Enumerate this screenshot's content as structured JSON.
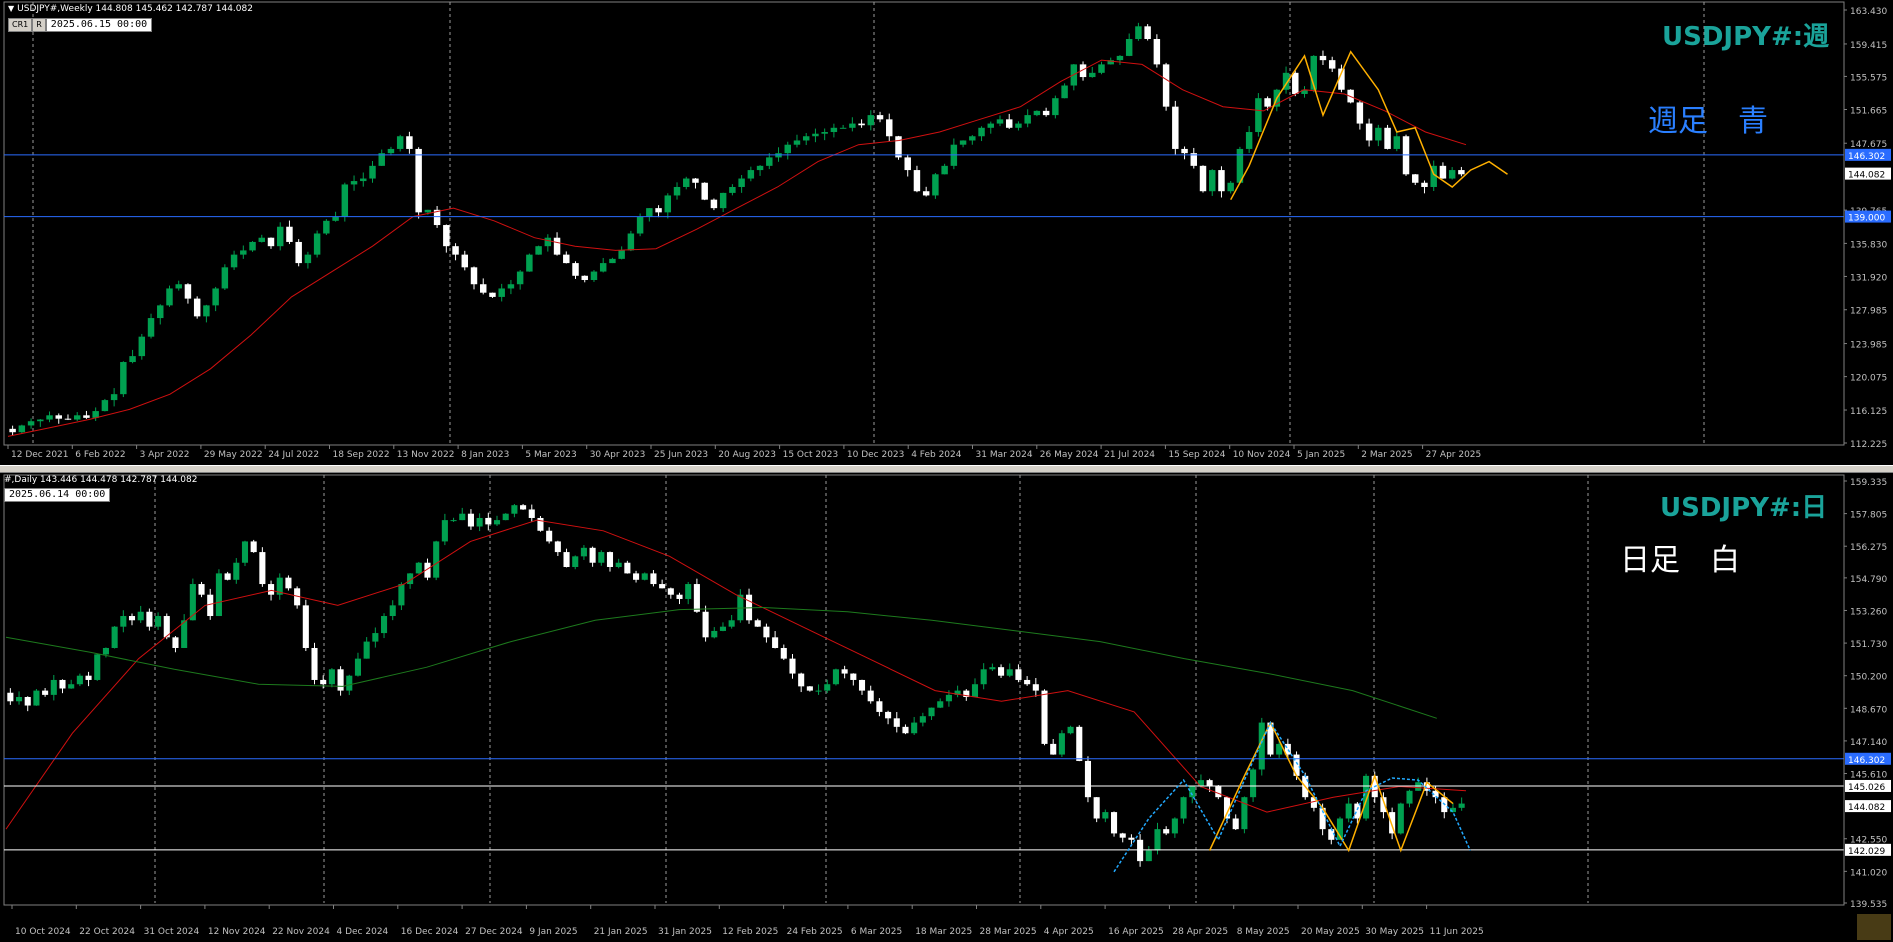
{
  "colors": {
    "up": "#00a050",
    "down": "#ffffff",
    "ma_red": "#d01010",
    "ma_green": "#1d7a1d",
    "hline_blue": "#2a6cff",
    "hline_white": "#ffffff",
    "wave_yellow": "#ffb000",
    "wave_cyan": "#22aaff",
    "symbol": "#1aa39a",
    "label_blue": "#2a7fff",
    "label_white": "#ffffff",
    "priceTag": "#2a6cff"
  },
  "top": {
    "header": "USDJPY#,Weekly  144.808 145.462 142.787 144.082",
    "btn1": "CR1",
    "btn2": "R",
    "date": "2025.06.15 00:00",
    "symbol": "USDJPY#:週",
    "caption": "週足　青",
    "yticks": [
      "163.430",
      "159.415",
      "155.575",
      "151.665",
      "147.675",
      "146.302",
      "144.082",
      "139.765",
      "139.000",
      "135.830",
      "131.920",
      "127.985",
      "123.985",
      "120.075",
      "116.125",
      "112.225"
    ],
    "xticks": [
      "12 Dec 2021",
      "6 Feb 2022",
      "3 Apr 2022",
      "29 May 2022",
      "24 Jul 2022",
      "18 Sep 2022",
      "13 Nov 2022",
      "8 Jan 2023",
      "5 Mar 2023",
      "30 Apr 2023",
      "25 Jun 2023",
      "20 Aug 2023",
      "15 Oct 2023",
      "10 Dec 2023",
      "4 Feb 2024",
      "31 Mar 2024",
      "26 May 2024",
      "21 Jul 2024",
      "15 Sep 2024",
      "10 Nov 2024",
      "5 Jan 2025",
      "2 Mar 2025",
      "27 Apr 2025"
    ]
  },
  "bottom": {
    "header": "#,Daily  143.446 144.478 142.787 144.082",
    "date": "2025.06.14 00:00",
    "symbol": "USDJPY#:日",
    "caption": "日足　白",
    "yticks": [
      "159.335",
      "157.805",
      "156.275",
      "154.790",
      "153.260",
      "151.730",
      "150.200",
      "148.670",
      "147.140",
      "146.302",
      "145.610",
      "145.026",
      "144.082",
      "142.550",
      "142.029",
      "141.020",
      "139.535"
    ],
    "xticks": [
      "10 Oct 2024",
      "22 Oct 2024",
      "31 Oct 2024",
      "12 Nov 2024",
      "22 Nov 2024",
      "4 Dec 2024",
      "16 Dec 2024",
      "27 Dec 2024",
      "9 Jan 2025",
      "21 Jan 2025",
      "31 Jan 2025",
      "12 Feb 2025",
      "24 Feb 2025",
      "6 Mar 2025",
      "18 Mar 2025",
      "28 Mar 2025",
      "4 Apr 2025",
      "16 Apr 2025",
      "28 Apr 2025",
      "8 May 2025",
      "20 May 2025",
      "30 May 2025",
      "11 Jun 2025"
    ]
  },
  "chart_data": [
    {
      "type": "candlestick",
      "title": "USDJPY#,Weekly",
      "ylim": [
        112.225,
        163.43
      ],
      "hlines": [
        146.302,
        139.0
      ],
      "last": 144.082,
      "closes": [
        113.5,
        114.3,
        114.8,
        115.0,
        115.5,
        115.1,
        115.0,
        115.5,
        115.2,
        116.0,
        117.3,
        118.0,
        121.8,
        122.5,
        124.8,
        127.0,
        128.5,
        130.5,
        131.0,
        129.3,
        127.2,
        128.5,
        130.5,
        133.0,
        134.5,
        135.0,
        136.0,
        136.5,
        135.5,
        137.8,
        136.0,
        133.5,
        134.5,
        137.0,
        138.5,
        139.0,
        142.8,
        143.2,
        143.5,
        145.0,
        146.5,
        147.0,
        148.5,
        147.0,
        139.5,
        139.8,
        138.0,
        135.5,
        134.5,
        133.0,
        131.0,
        130.0,
        129.5,
        130.5,
        131.0,
        132.5,
        134.5,
        135.5,
        136.5,
        134.5,
        133.5,
        132.0,
        131.5,
        132.5,
        133.5,
        134.0,
        135.0,
        137.0,
        139.0,
        140.0,
        139.5,
        141.5,
        142.5,
        143.5,
        143.0,
        141.0,
        140.0,
        141.8,
        142.5,
        143.5,
        144.5,
        145.0,
        146.0,
        146.5,
        147.5,
        148.0,
        148.5,
        148.8,
        149.0,
        149.5,
        149.5,
        150.0,
        149.8,
        151.0,
        150.5,
        148.5,
        146.0,
        144.5,
        142.0,
        141.5,
        144.0,
        145.0,
        147.5,
        148.0,
        148.5,
        149.5,
        150.0,
        150.5,
        149.5,
        150.0,
        151.0,
        151.5,
        151.0,
        153.0,
        154.5,
        157.0,
        155.5,
        156.0,
        157.0,
        157.5,
        158.0,
        160.0,
        161.5,
        160.0,
        157.0,
        152.0,
        147.0,
        146.5,
        145.0,
        142.0,
        144.5,
        142.0,
        143.0,
        147.0,
        149.0,
        153.0,
        152.0,
        154.0,
        156.0,
        153.5,
        154.0,
        158.0,
        157.5,
        156.5,
        154.0,
        152.5,
        150.0,
        148.0,
        149.5,
        147.0,
        148.5,
        144.0,
        143.0,
        142.5,
        145.0,
        143.5,
        144.5,
        144.0
      ],
      "ma_red": [
        113.0,
        114.0,
        115.0,
        116.2,
        118.0,
        121.0,
        125.0,
        129.5,
        132.5,
        135.5,
        139.0,
        140.0,
        138.5,
        136.5,
        135.5,
        135.0,
        135.2,
        137.5,
        140.0,
        142.5,
        145.5,
        147.5,
        148.0,
        149.0,
        150.5,
        152.0,
        155.0,
        157.5,
        157.0,
        154.0,
        152.0,
        151.5,
        154.0,
        153.5,
        151.5,
        149.0,
        147.5
      ],
      "series": [
        {
          "name": "USDJPY#,Weekly",
          "values": [
            144.808,
            145.462,
            142.787,
            144.082
          ]
        }
      ]
    },
    {
      "type": "candlestick",
      "title": "#,Daily",
      "ylim": [
        139.535,
        159.335
      ],
      "hlines": [
        146.302,
        145.026,
        142.029
      ],
      "last": 144.082,
      "closes": [
        149.0,
        149.2,
        148.8,
        149.5,
        149.3,
        150.0,
        149.6,
        149.8,
        150.2,
        150.0,
        151.2,
        151.5,
        152.5,
        153.0,
        152.8,
        153.2,
        152.5,
        153.0,
        152.0,
        151.5,
        152.8,
        154.5,
        154.0,
        153.0,
        155.0,
        154.7,
        155.5,
        156.5,
        156.0,
        154.5,
        154.0,
        154.8,
        154.3,
        153.5,
        151.5,
        150.0,
        149.8,
        150.5,
        149.5,
        150.2,
        151.0,
        151.8,
        152.2,
        153.0,
        153.5,
        154.5,
        155.0,
        155.5,
        154.8,
        156.5,
        157.5,
        157.5,
        157.8,
        157.2,
        157.6,
        157.3,
        157.5,
        157.8,
        158.2,
        158.0,
        157.6,
        157.0,
        156.5,
        156.0,
        155.3,
        155.8,
        156.2,
        155.5,
        156.0,
        155.3,
        155.5,
        155.0,
        154.7,
        155.0,
        154.5,
        154.3,
        154.0,
        153.8,
        154.5,
        153.2,
        152.0,
        152.3,
        152.5,
        152.8,
        154.0,
        152.8,
        152.5,
        152.0,
        151.5,
        151.0,
        150.3,
        149.7,
        149.5,
        149.5,
        149.8,
        150.5,
        150.3,
        150.0,
        149.5,
        149.0,
        148.5,
        148.2,
        147.8,
        147.5,
        148.0,
        148.3,
        148.7,
        149.0,
        149.3,
        149.5,
        149.2,
        149.8,
        150.5,
        150.6,
        150.2,
        150.5,
        150.0,
        149.8,
        149.5,
        147.0,
        146.5,
        147.5,
        147.8,
        146.2,
        144.5,
        143.5,
        143.8,
        142.8,
        142.6,
        142.5,
        141.5,
        142.0,
        143.0,
        142.8,
        143.5,
        144.5,
        145.0,
        145.3,
        145.0,
        144.5,
        143.5,
        143.0,
        144.5,
        145.8,
        148.0,
        146.5,
        147.0,
        146.5,
        145.5,
        144.5,
        144.0,
        143.0,
        142.5,
        143.5,
        144.2,
        143.5,
        145.5,
        144.5,
        143.8,
        142.8,
        144.2,
        144.8,
        145.2,
        144.8,
        144.5,
        143.8,
        144.0,
        144.2
      ],
      "ma_red": [
        143.0,
        147.5,
        151.0,
        153.5,
        154.2,
        153.5,
        154.5,
        156.5,
        157.5,
        157.0,
        155.8,
        154.0,
        152.5,
        151.0,
        149.5,
        149.0,
        149.5,
        148.5,
        145.0,
        143.8,
        144.5,
        145.0,
        144.8
      ],
      "ma_green": [
        152.0,
        151.3,
        150.5,
        149.8,
        149.7,
        150.6,
        151.8,
        152.8,
        153.3,
        153.4,
        153.2,
        152.8,
        152.3,
        151.8,
        151.0,
        150.3,
        149.5,
        148.2
      ],
      "series": [
        {
          "name": "#,Daily",
          "values": [
            143.446,
            144.478,
            142.787,
            144.082
          ]
        }
      ]
    }
  ]
}
